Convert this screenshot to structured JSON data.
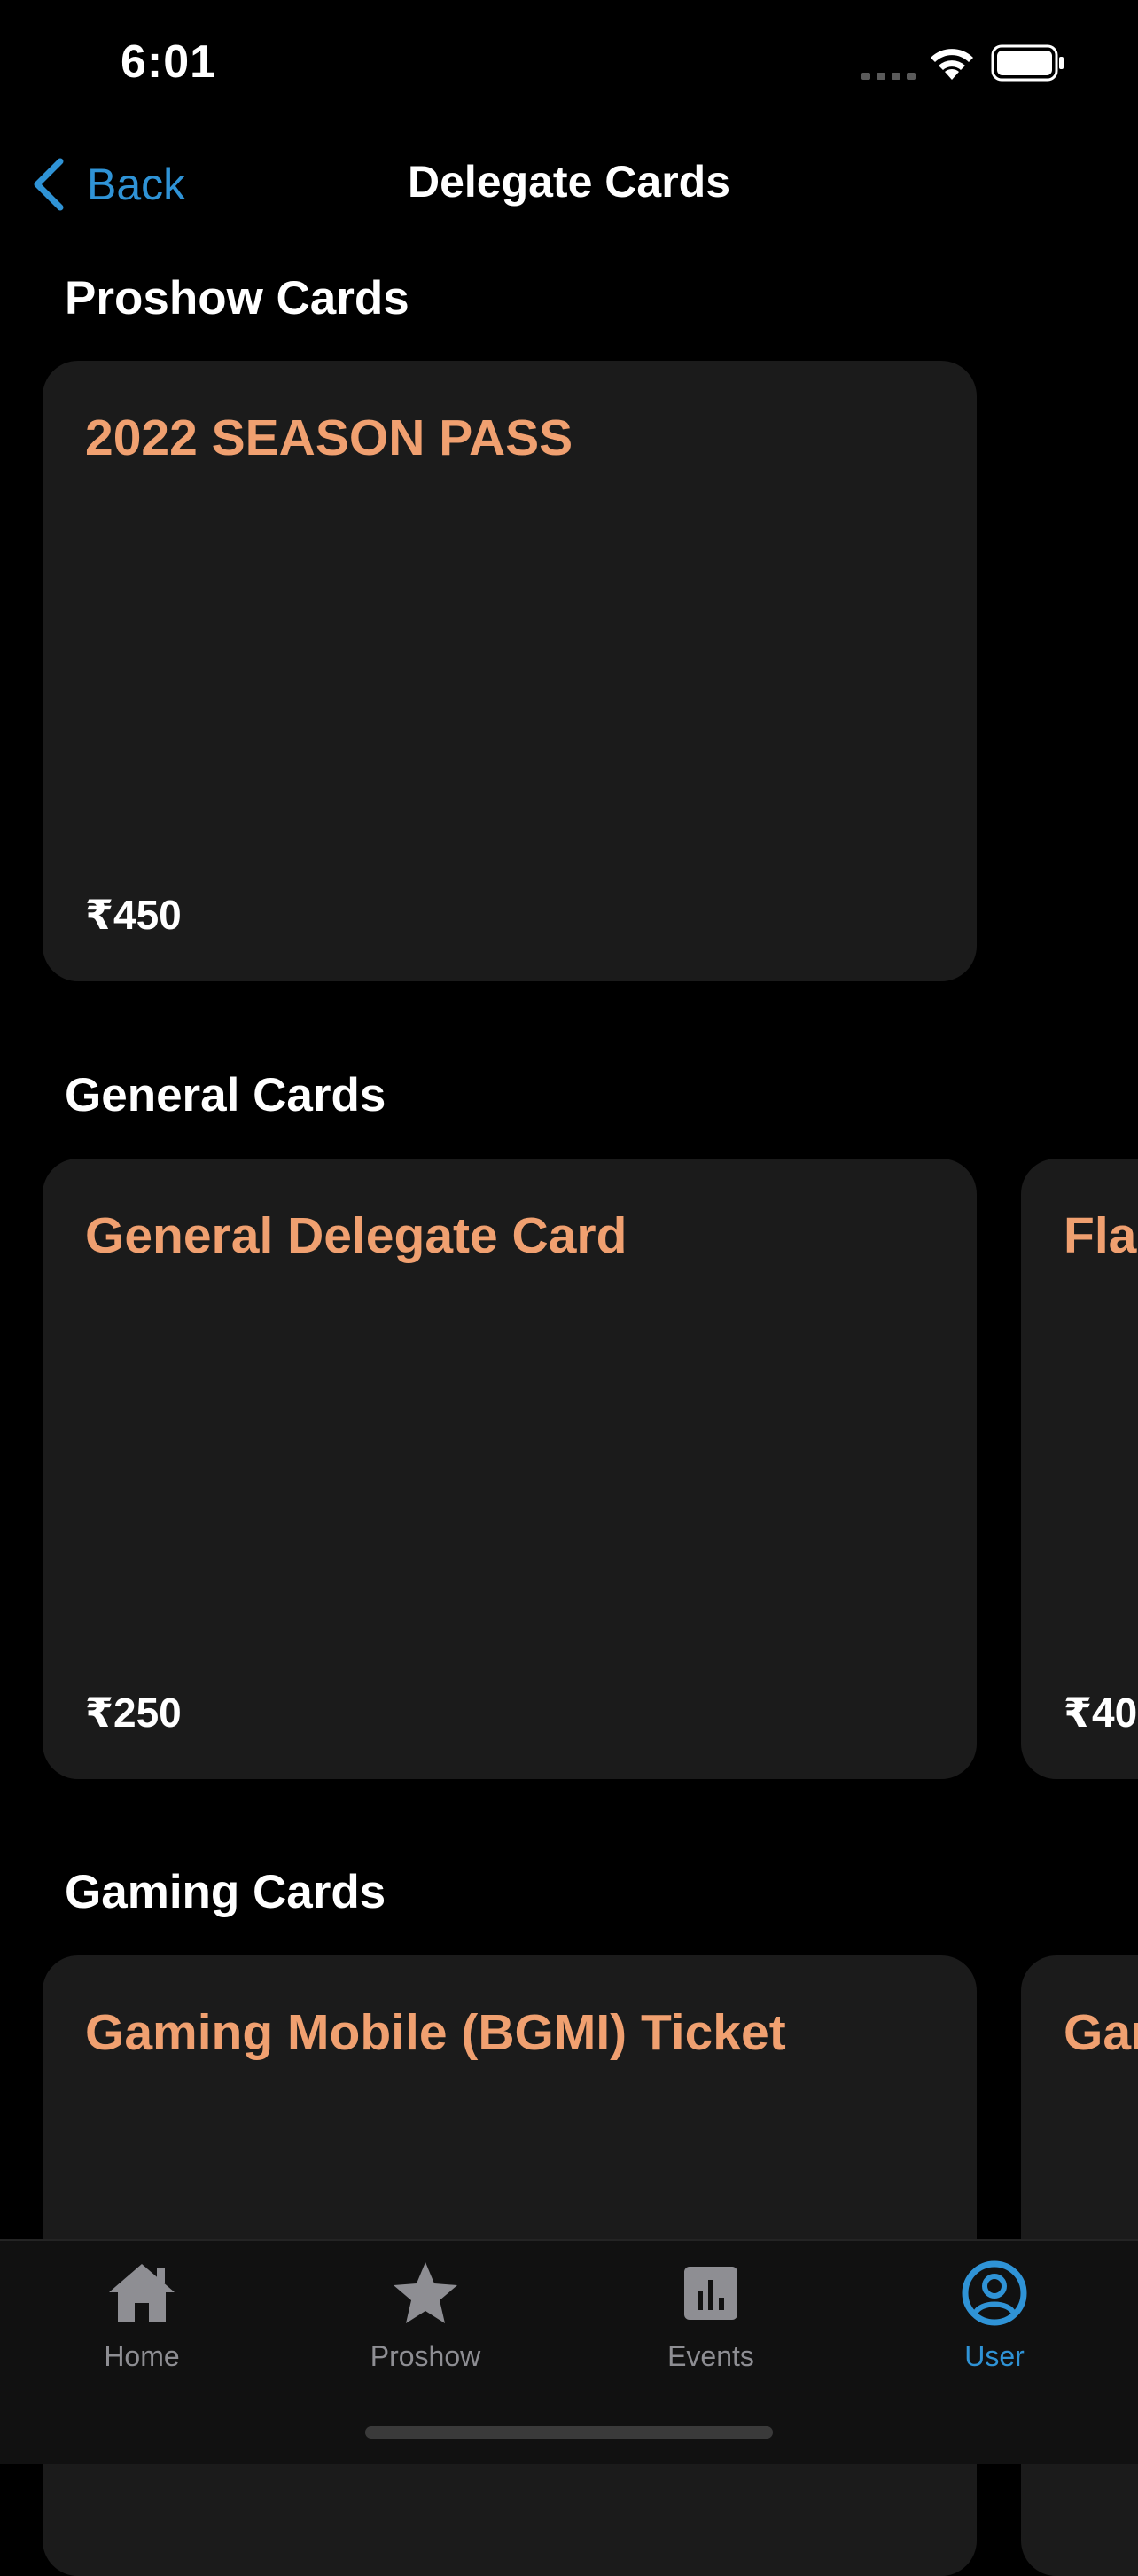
{
  "status_bar": {
    "time": "6:01"
  },
  "nav": {
    "back_label": "Back",
    "title": "Delegate Cards"
  },
  "sections": [
    {
      "title": "Proshow Cards",
      "cards": [
        {
          "title": "2022 SEASON PASS",
          "price": "₹450"
        }
      ]
    },
    {
      "title": "General Cards",
      "cards": [
        {
          "title": "General Delegate Card",
          "price": "₹250"
        },
        {
          "title": "Fla",
          "price": "₹40"
        }
      ]
    },
    {
      "title": "Gaming Cards",
      "cards": [
        {
          "title": "Gaming Mobile (BGMI) Ticket",
          "price": ""
        },
        {
          "title": "Gar",
          "price": ""
        }
      ]
    }
  ],
  "tab_bar": {
    "items": [
      {
        "label": "Home",
        "icon": "home-icon"
      },
      {
        "label": "Proshow",
        "icon": "star-icon"
      },
      {
        "label": "Events",
        "icon": "bar-chart-icon"
      },
      {
        "label": "User",
        "icon": "user-circle-icon",
        "active": true
      }
    ]
  },
  "colors": {
    "accent": "#2f93d6",
    "card_title": "#f0a070",
    "card_bg": "#1b1b1b"
  }
}
